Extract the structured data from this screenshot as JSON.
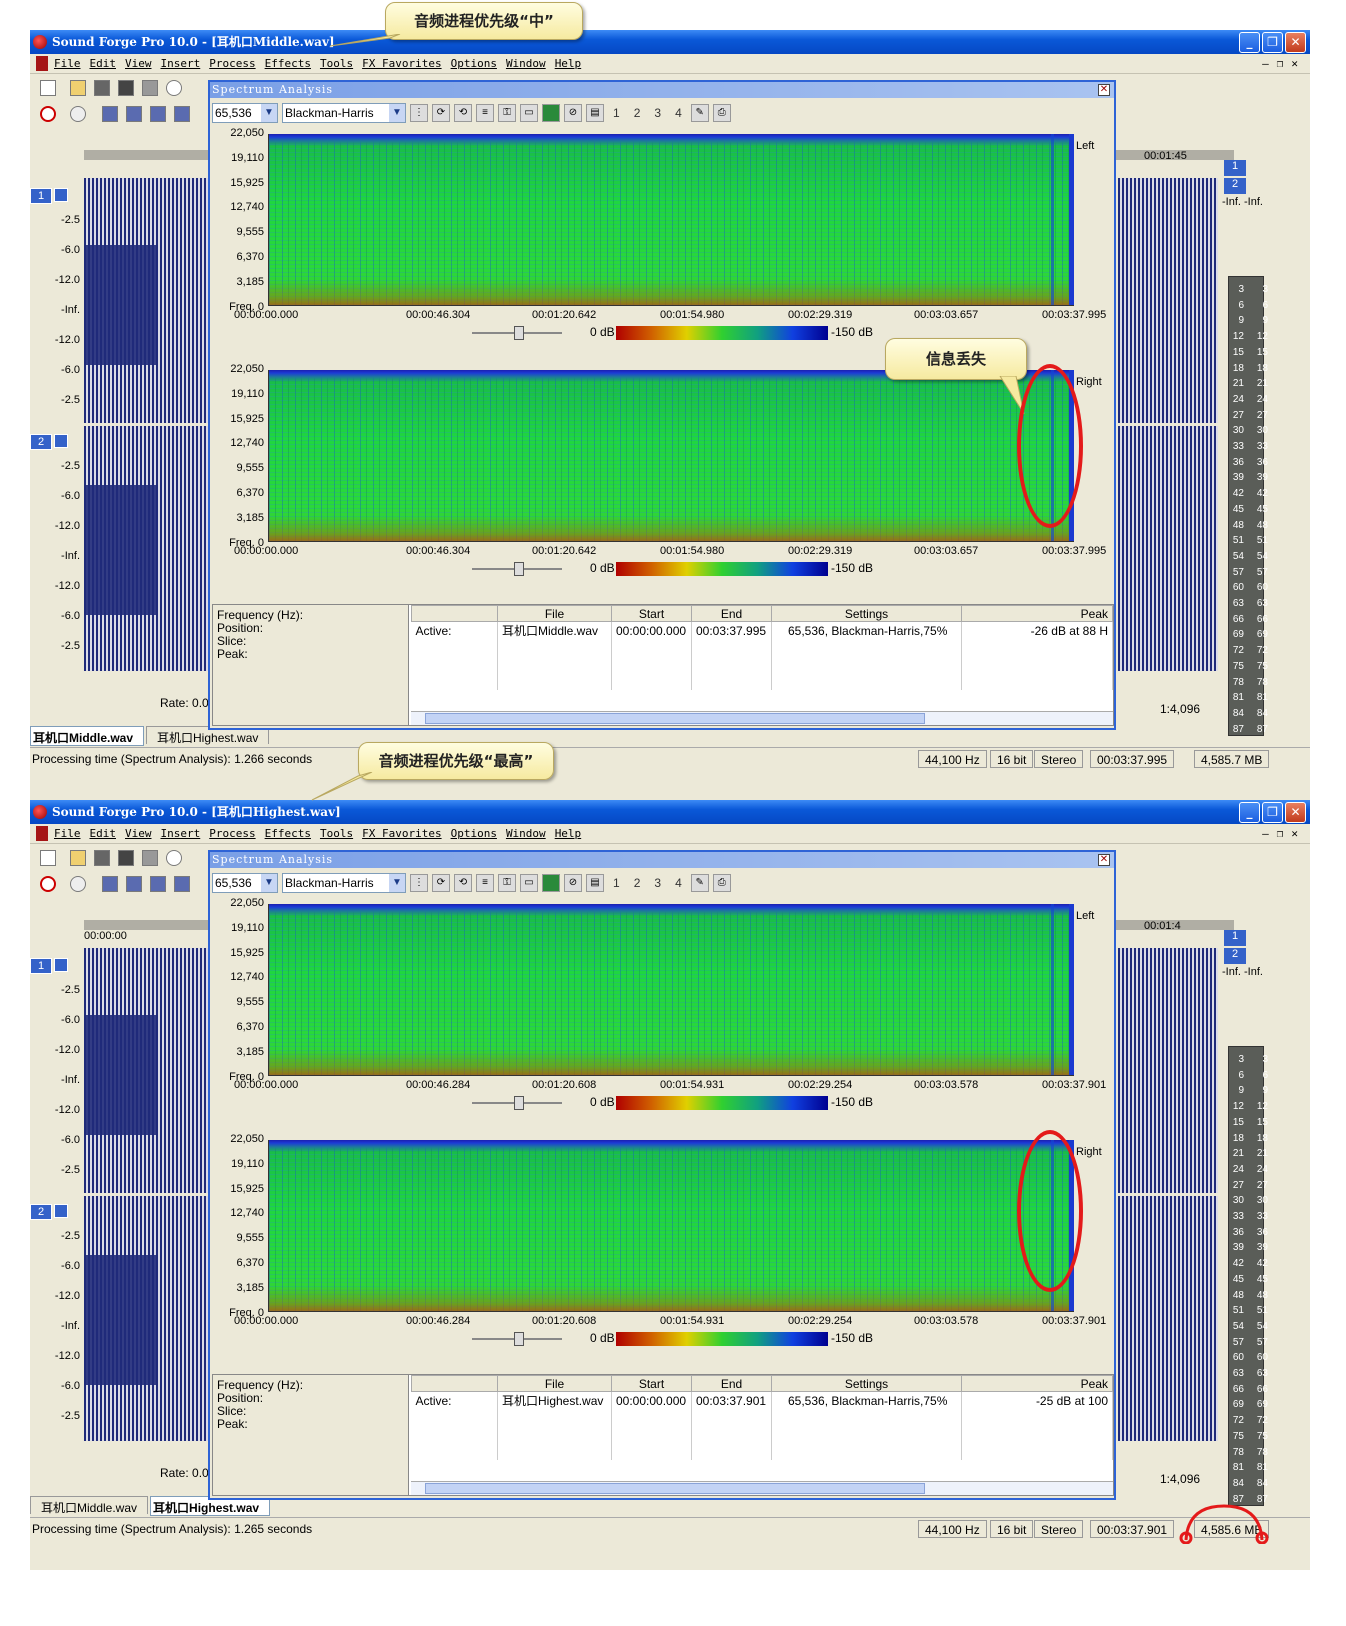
{
  "app": {
    "menu": [
      "File",
      "Edit",
      "View",
      "Insert",
      "Process",
      "Effects",
      "Tools",
      "FX Favorites",
      "Options",
      "Window",
      "Help"
    ],
    "window_buttons": [
      "_",
      "❐",
      "✕"
    ]
  },
  "callouts": {
    "top": "音频进程优先级“中”",
    "bottom": "音频进程优先级“最高”",
    "loss": "信息丢失"
  },
  "common": {
    "spectrum_title": "Spectrum Analysis",
    "fft_size": "65,536",
    "window_fn": "Blackman-Harris",
    "slices": [
      "1",
      "2",
      "3",
      "4"
    ],
    "freq_labels": [
      "22,050",
      "19,110",
      "15,925",
      "12,740",
      "9,555",
      "6,370",
      "3,185",
      "Freq. 0"
    ],
    "left_label": "Left",
    "right_label": "Right",
    "db_min": "0 dB",
    "db_max": "-150 dB",
    "info_labels": "Frequency (Hz):\nPosition:\nSlice:\nPeak:",
    "table_headers": [
      "File",
      "Start",
      "End",
      "Settings",
      "Peak"
    ],
    "rate": "Rate: 0.0",
    "zoom": "1:4,096",
    "sample_rate": "44,100 Hz",
    "bit_depth": "16 bit",
    "channels": "Stereo",
    "db_scale": [
      "-2.5",
      "-6.0",
      "-12.0",
      "-Inf.",
      "-12.0",
      "-6.0",
      "-2.5"
    ],
    "meter_ticks": [
      "3",
      "6",
      "9",
      "12",
      "15",
      "18",
      "21",
      "24",
      "27",
      "30",
      "33",
      "36",
      "39",
      "42",
      "45",
      "48",
      "51",
      "54",
      "57",
      "60",
      "63",
      "66",
      "69",
      "72",
      "75",
      "78",
      "81",
      "84",
      "87"
    ],
    "meter_top": "-Inf. -Inf."
  },
  "panels": [
    {
      "title": "Sound Forge Pro 10.0 - [耳机口Middle.wav]",
      "times": [
        "00:00:00.000",
        "00:00:46.304",
        "00:01:20.642",
        "00:01:54.980",
        "00:02:29.319",
        "00:03:03.657",
        "00:03:37.995"
      ],
      "row": {
        "active": "Active:",
        "file": "耳机口Middle.wav",
        "start": "00:00:00.000",
        "end": "00:03:37.995",
        "settings": "65,536, Blackman-Harris,75%",
        "peak": "-26 dB at 88 H"
      },
      "tabs": [
        "耳机口Middle.wav",
        "耳机口Highest.wav"
      ],
      "selected_tab": 0,
      "status": "Processing time (Spectrum Analysis): 1.266 seconds",
      "length": "00:03:37.995",
      "disk": "4,585.7 MB",
      "ruler_right": "00:01:45",
      "ruler_left": ""
    },
    {
      "title": "Sound Forge Pro 10.0 - [耳机口Highest.wav]",
      "times": [
        "00:00:00.000",
        "00:00:46.284",
        "00:01:20.608",
        "00:01:54.931",
        "00:02:29.254",
        "00:03:03.578",
        "00:03:37.901"
      ],
      "row": {
        "active": "Active:",
        "file": "耳机口Highest.wav",
        "start": "00:00:00.000",
        "end": "00:03:37.901",
        "settings": "65,536, Blackman-Harris,75%",
        "peak": "-25 dB at 100"
      },
      "tabs": [
        "耳机口Middle.wav",
        "耳机口Highest.wav"
      ],
      "selected_tab": 1,
      "status": "Processing time (Spectrum Analysis): 1.265 seconds",
      "length": "00:03:37.901",
      "disk": "4,585.6 MB",
      "ruler_right": "00:01:4",
      "ruler_left": "00:00:00"
    }
  ]
}
